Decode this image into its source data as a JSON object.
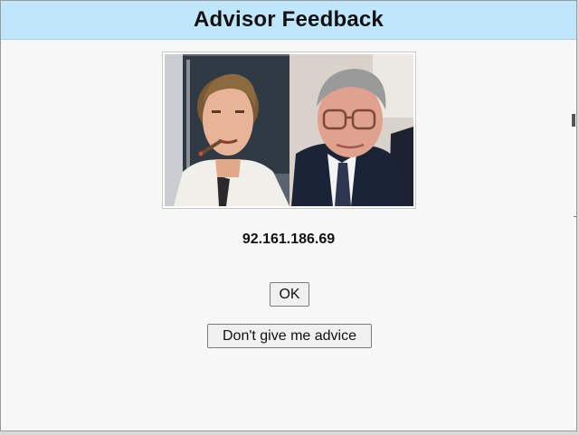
{
  "dialog": {
    "title": "Advisor Feedback",
    "ip_address": "92.161.186.69",
    "photo_icon": "advisors-photo",
    "ok_label": "OK",
    "decline_label": "Don't give me advice"
  },
  "colors": {
    "titlebar_bg": "#bfe6fb",
    "window_bg": "#f7f7f7"
  }
}
